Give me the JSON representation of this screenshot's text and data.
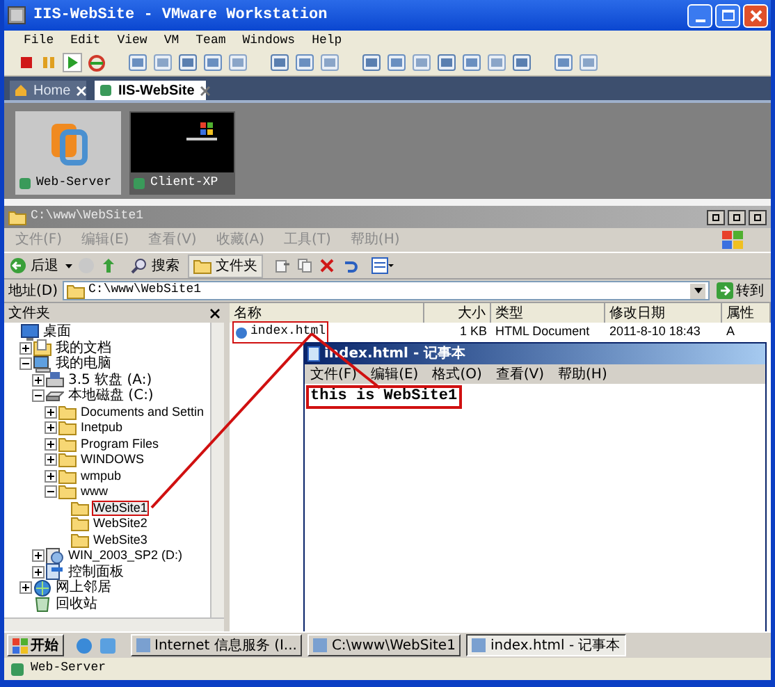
{
  "window": {
    "title": "IIS-WebSite - VMware Workstation"
  },
  "menu": [
    "File",
    "Edit",
    "View",
    "VM",
    "Team",
    "Windows",
    "Help"
  ],
  "tabs": [
    {
      "label": "Home",
      "selected": false
    },
    {
      "label": "IIS-WebSite",
      "selected": true
    }
  ],
  "vms": [
    {
      "name": "Web-Server",
      "selected": true,
      "kind": "logo"
    },
    {
      "name": "Client-XP",
      "selected": false,
      "kind": "screen"
    }
  ],
  "explorer": {
    "title": "C:\\www\\WebSite1",
    "menu": [
      "文件(F)",
      "编辑(E)",
      "查看(V)",
      "收藏(A)",
      "工具(T)",
      "帮助(H)"
    ],
    "toolbar": {
      "back": "后退",
      "search": "搜索",
      "folders": "文件夹"
    },
    "address": {
      "label": "地址(D)",
      "value": "C:\\www\\WebSite1",
      "go": "转到"
    },
    "folders_title": "文件夹",
    "tree": [
      {
        "label": "桌面",
        "kind": "desktop",
        "children": [
          {
            "label": "我的文档",
            "kind": "documents",
            "expanded": false
          },
          {
            "label": "我的电脑",
            "kind": "computer",
            "expanded": true,
            "children": [
              {
                "label": "3.5 软盘 (A:)",
                "kind": "floppy",
                "expanded": false
              },
              {
                "label": "本地磁盘 (C:)",
                "kind": "drive",
                "expanded": true,
                "children": [
                  {
                    "label": "Documents and Settin",
                    "kind": "folder",
                    "expanded": false
                  },
                  {
                    "label": "Inetpub",
                    "kind": "folder",
                    "expanded": false
                  },
                  {
                    "label": "Program Files",
                    "kind": "folder",
                    "expanded": false
                  },
                  {
                    "label": "WINDOWS",
                    "kind": "folder",
                    "expanded": false
                  },
                  {
                    "label": "wmpub",
                    "kind": "folder",
                    "expanded": false
                  },
                  {
                    "label": "www",
                    "kind": "folder",
                    "expanded": true,
                    "children": [
                      {
                        "label": "WebSite1",
                        "kind": "folder",
                        "selected": true
                      },
                      {
                        "label": "WebSite2",
                        "kind": "folder",
                        "selected": false
                      },
                      {
                        "label": "WebSite3",
                        "kind": "folder",
                        "selected": false
                      }
                    ]
                  }
                ]
              },
              {
                "label": "WIN_2003_SP2 (D:)",
                "kind": "cdrom",
                "expanded": false
              },
              {
                "label": "控制面板",
                "kind": "control",
                "expanded": false
              }
            ]
          },
          {
            "label": "网上邻居",
            "kind": "network",
            "expanded": false
          },
          {
            "label": "回收站",
            "kind": "recycle"
          }
        ]
      }
    ],
    "columns": [
      "名称",
      "大小",
      "类型",
      "修改日期",
      "属性"
    ],
    "rows": [
      {
        "name": "index.html",
        "size": "1 KB",
        "type": "HTML Document",
        "modified": "2011-8-10 18:43",
        "attributes": "A"
      }
    ]
  },
  "notepad": {
    "title": "index.html - 记事本",
    "menu": [
      "文件(F)",
      "编辑(E)",
      "格式(O)",
      "查看(V)",
      "帮助(H)"
    ],
    "text": "this is WebSite1"
  },
  "taskbar": {
    "start": "开始",
    "tasks": [
      {
        "label": "Internet 信息服务 (I...",
        "selected": false
      },
      {
        "label": "C:\\www\\WebSite1",
        "selected": false
      },
      {
        "label": "index.html - 记事本",
        "selected": true
      }
    ]
  },
  "status_bar": "Web-Server"
}
